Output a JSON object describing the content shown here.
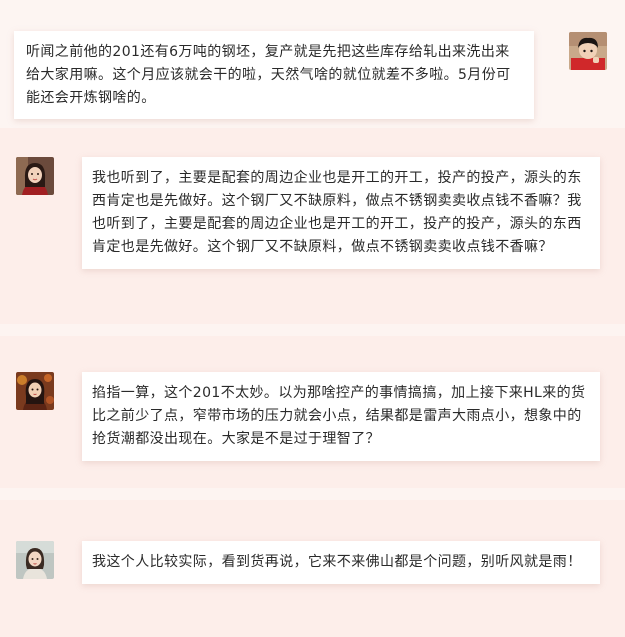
{
  "messages": [
    {
      "side": "right",
      "avatar_icon": "boy-avatar-red-shirt",
      "text": "听闻之前他的201还有6万吨的钢坯，复产就是先把这些库存给轧出来洗出来给大家用嘛。这个月应该就会干的啦，天然气啥的就位就差不多啦。5月份可能还会开炼钢啥的。"
    },
    {
      "side": "left",
      "avatar_icon": "woman-avatar-red-top",
      "text": "我也听到了，主要是配套的周边企业也是开工的开工，投产的投产，源头的东西肯定也是先做好。这个钢厂又不缺原料，做点不锈钢卖卖收点钱不香嘛？我也听到了，主要是配套的周边企业也是开工的开工，投产的投产，源头的东西肯定也是先做好。这个钢厂又不缺原料，做点不锈钢卖卖收点钱不香嘛？"
    },
    {
      "side": "left",
      "avatar_icon": "girl-avatar-autumn",
      "text": "掐指一算，这个201不太妙。以为那啥控产的事情搞搞，加上接下来HL来的货比之前少了点，窄带市场的压力就会小点，结果都是雷声大雨点小，想象中的抢货潮都没出现在。大家是不是过于理智了？"
    },
    {
      "side": "left",
      "avatar_icon": "girl-avatar-short-hair",
      "text": "我这个人比较实际，看到货再说，它来不来佛山都是个问题，别听风就是雨！"
    }
  ]
}
